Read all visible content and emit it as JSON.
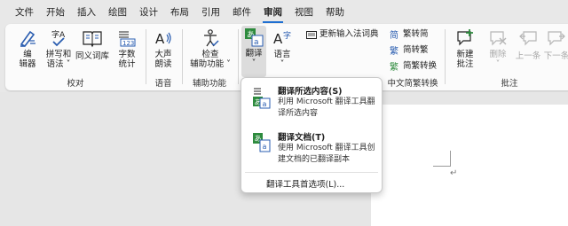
{
  "tabs": [
    "文件",
    "开始",
    "插入",
    "绘图",
    "设计",
    "布局",
    "引用",
    "邮件",
    "审阅",
    "视图",
    "帮助"
  ],
  "active_tab": "审阅",
  "ribbon": {
    "proofing": {
      "spelling_line1": "编",
      "spelling_line2": "辑器",
      "grammar_line1": "拼写和",
      "grammar_line2": "语法 ˅",
      "thesaurus": "同义词库",
      "wordcount_line1": "字数",
      "wordcount_line2": "统计",
      "group_label": "校对"
    },
    "speech": {
      "readaloud_line1": "大声",
      "readaloud_line2": "朗读",
      "group_label": "语音"
    },
    "accessibility": {
      "check_line1": "检查",
      "check_line2": "辅助功能 ˅",
      "group_label": "辅助功能"
    },
    "language": {
      "translate_line1": "翻译",
      "translate_line2": "˅",
      "lang_line1": "语言",
      "lang_line2": "˅",
      "update_ime": "更新输入法词典"
    },
    "chinese_conversion": {
      "to_simplified": "繁转简",
      "to_traditional": "简转繁",
      "conversion": "简繁转换",
      "group_label": "中文简繁转换"
    },
    "comments": {
      "new_line1": "新建",
      "new_line2": "批注",
      "delete_line1": "删除",
      "delete_line2": "˅",
      "prev": "上一条",
      "next": "下一条",
      "group_label": "批注"
    }
  },
  "dropdown": {
    "translate_selection_title": "翻译所选内容(S)",
    "translate_selection_desc": "利用 Microsoft 翻译工具翻译所选内容",
    "translate_doc_title": "翻译文档(T)",
    "translate_doc_desc": "使用 Microsoft 翻译工具创建文档的已翻译副本",
    "preferences": "翻译工具首选项(L)..."
  },
  "document": {
    "paragraph_mark": "↵"
  },
  "colors": {
    "accent": "#1f6fd1",
    "icon_blue": "#2a5db0",
    "icon_green": "#2e8b3e"
  }
}
